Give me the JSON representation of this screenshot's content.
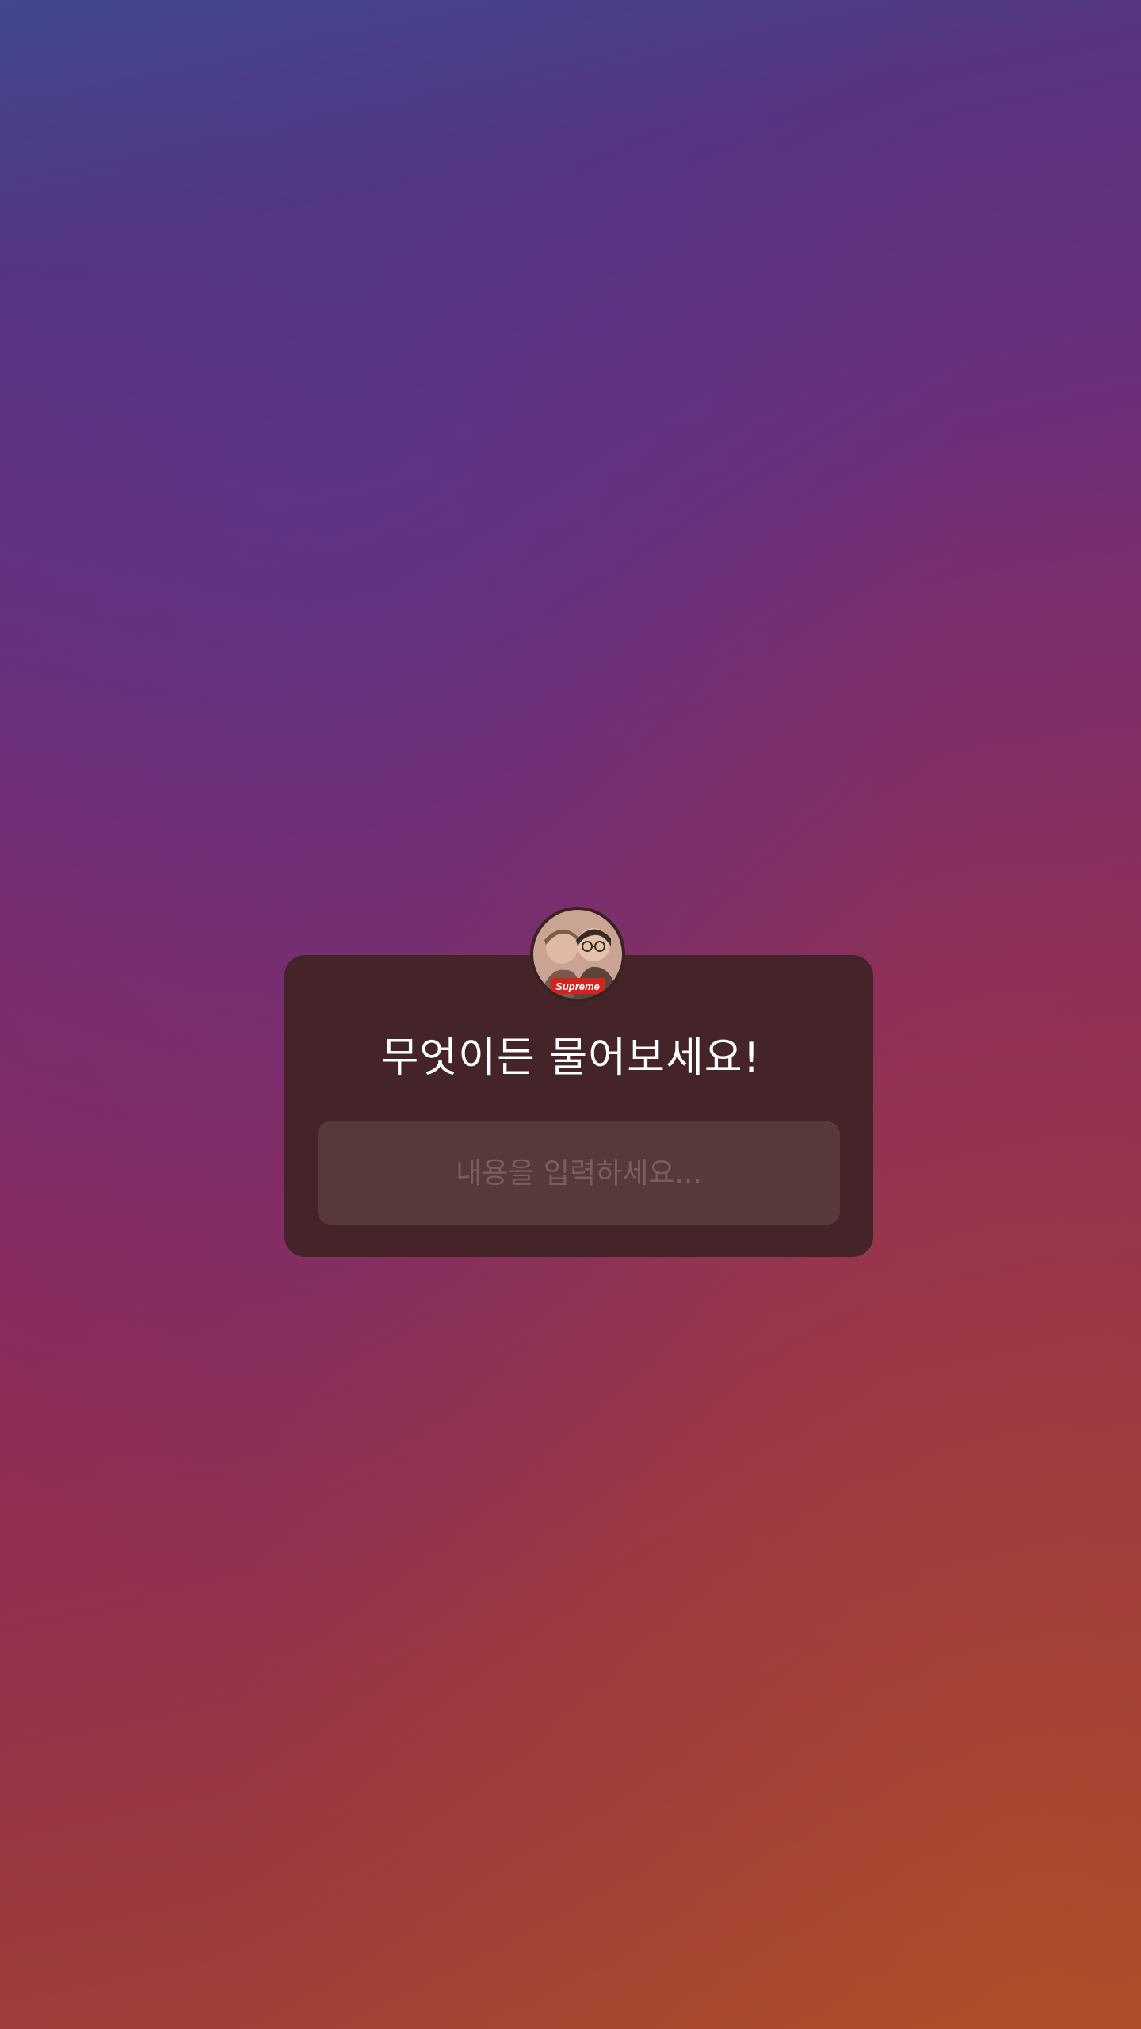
{
  "question_sticker": {
    "title": "무엇이든 물어보세요!",
    "input_placeholder": "내용을 입력하세요...",
    "input_value": "",
    "avatar": {
      "icon": "profile-avatar-icon",
      "logo_text": "Supreme"
    }
  },
  "colors": {
    "background_top": "#3f4a8e",
    "background_middle": "#7c2b6d",
    "background_bottom": "#a5492f",
    "card_background": "#442428",
    "input_background": "#57393a",
    "title_text": "#ffffff",
    "placeholder_text": "#7a5d5e"
  }
}
